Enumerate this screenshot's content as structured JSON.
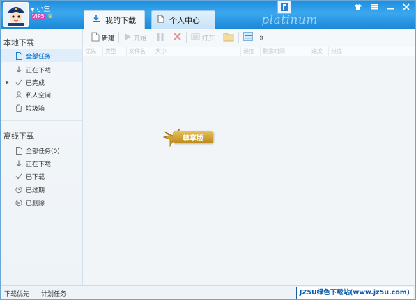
{
  "user": {
    "name": "小生",
    "vip_badge": "VIP5"
  },
  "title_decoration": "platinum",
  "tabs": [
    {
      "label": "我的下载",
      "active": true
    },
    {
      "label": "个人中心",
      "active": false
    }
  ],
  "sidebar": {
    "local_title": "本地下载",
    "local_items": [
      {
        "label": "全部任务",
        "selected": true,
        "icon": "file-icon"
      },
      {
        "label": "正在下载",
        "icon": "download-icon"
      },
      {
        "label": "已完成",
        "icon": "check-icon",
        "has_expander": true
      },
      {
        "label": "私人空间",
        "icon": "private-space-icon"
      },
      {
        "label": "垃圾箱",
        "icon": "trash-icon"
      }
    ],
    "offline_title": "离线下载",
    "offline_items": [
      {
        "label": "全部任务(0)",
        "icon": "file-icon"
      },
      {
        "label": "正在下载",
        "icon": "download-icon"
      },
      {
        "label": "已下载",
        "icon": "check-icon"
      },
      {
        "label": "已过期",
        "icon": "clock-icon"
      },
      {
        "label": "已删除",
        "icon": "delete-circle-icon"
      }
    ]
  },
  "toolbar": {
    "new_label": "新建",
    "start_label": "开始",
    "open_label": "打开",
    "more_label": "»"
  },
  "columns": [
    "优先",
    "类型",
    "文件名",
    "大小",
    "进度",
    "剩余时间",
    "速度",
    "热度"
  ],
  "vip_seal_text": "尊享版",
  "statusbar": {
    "priority_label": "下载优先",
    "schedule_label": "计划任务",
    "watermark": "JZ5U绿色下载站(www.jz5u.com)"
  },
  "colors": {
    "titlebar_blue": "#2a9be8",
    "selected_text": "#1c7fd0",
    "selected_bg": "#dfeefa",
    "vip_gold": "#d0a230"
  }
}
